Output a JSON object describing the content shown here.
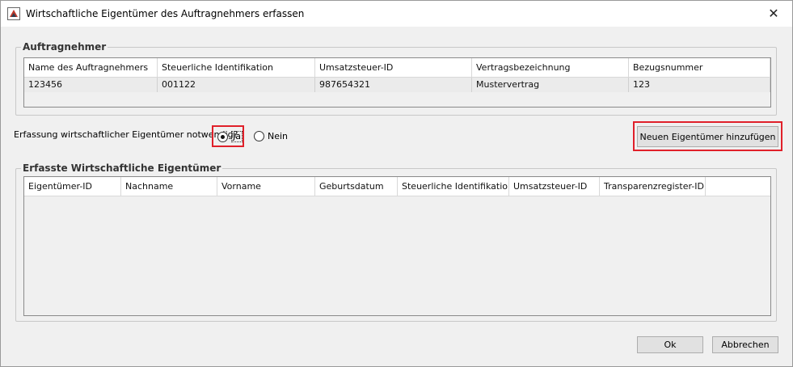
{
  "window": {
    "title": "Wirtschaftliche Eigentümer des Auftragnehmers erfassen",
    "close_glyph": "✕"
  },
  "auftragnehmer": {
    "group_title": "Auftragnehmer",
    "columns": [
      "Name des Auftragnehmers",
      "Steuerliche Identifikation",
      "Umsatzsteuer-ID",
      "Vertragsbezeichnung",
      "Bezugsnummer"
    ],
    "rows": [
      [
        "123456",
        "001122",
        "987654321",
        "Mustervertrag",
        "123"
      ]
    ]
  },
  "question": {
    "label": "Erfassung wirtschaftlicher Eigentümer notwendig?",
    "options": [
      {
        "label": "Ja",
        "selected": true
      },
      {
        "label": "Nein",
        "selected": false
      }
    ]
  },
  "add_button": {
    "label": "Neuen Eigentümer hinzufügen"
  },
  "eigentuemer": {
    "group_title": "Erfasste Wirtschaftliche Eigentümer",
    "columns": [
      "Eigentümer-ID",
      "Nachname",
      "Vorname",
      "Geburtsdatum",
      "Steuerliche Identifikation",
      "Umsatzsteuer-ID",
      "Transparenzregister-ID"
    ],
    "rows": []
  },
  "footer": {
    "ok_label": "Ok",
    "cancel_label": "Abbrechen"
  },
  "colors": {
    "highlight": "#e0202a",
    "window_bg": "#f0f0f0"
  }
}
